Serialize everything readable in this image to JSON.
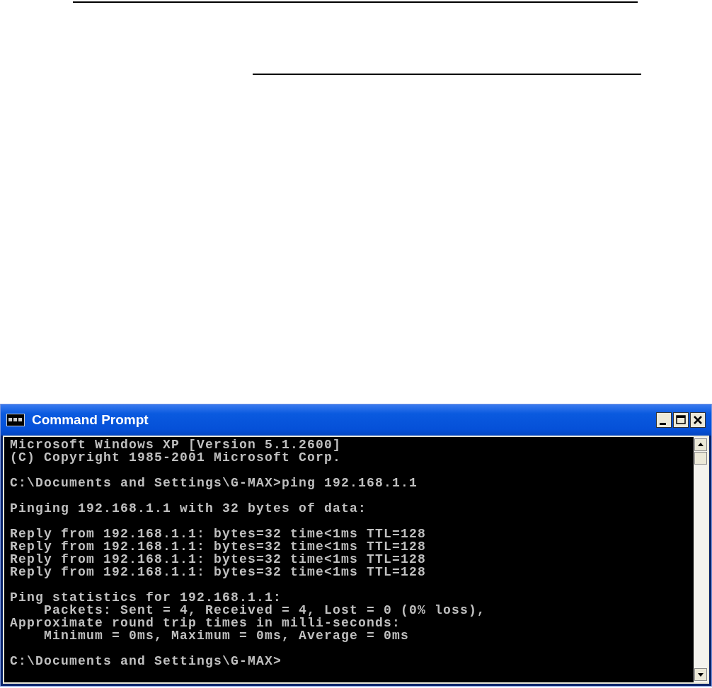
{
  "window": {
    "title": "Command Prompt"
  },
  "console": {
    "blocks": [
      {
        "lines": [
          "Microsoft Windows XP [Version 5.1.2600]",
          "(C) Copyright 1985-2001 Microsoft Corp."
        ]
      },
      {
        "lines": [
          "C:\\Documents and Settings\\G-MAX>ping 192.168.1.1"
        ]
      },
      {
        "lines": [
          "Pinging 192.168.1.1 with 32 bytes of data:"
        ]
      },
      {
        "lines": [
          "Reply from 192.168.1.1: bytes=32 time<1ms TTL=128",
          "Reply from 192.168.1.1: bytes=32 time<1ms TTL=128",
          "Reply from 192.168.1.1: bytes=32 time<1ms TTL=128",
          "Reply from 192.168.1.1: bytes=32 time<1ms TTL=128"
        ]
      },
      {
        "lines": [
          "Ping statistics for 192.168.1.1:",
          "    Packets: Sent = 4, Received = 4, Lost = 0 (0% loss),",
          "Approximate round trip times in milli-seconds:",
          "    Minimum = 0ms, Maximum = 0ms, Average = 0ms"
        ]
      },
      {
        "lines": [
          "C:\\Documents and Settings\\G-MAX>"
        ]
      }
    ]
  }
}
